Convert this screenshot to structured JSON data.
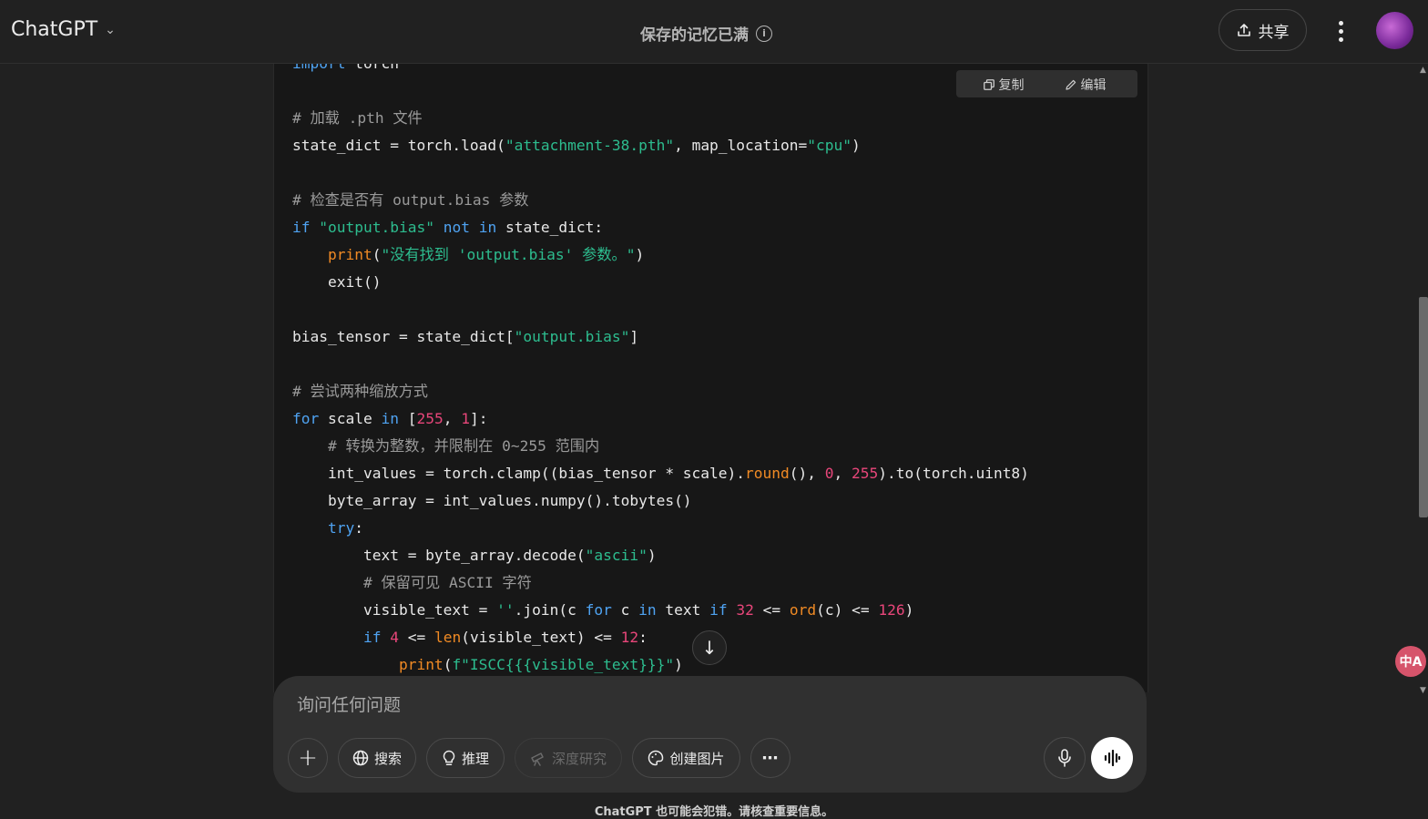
{
  "header": {
    "model_name": "ChatGPT",
    "memory_notice": "保存的记忆已满",
    "share_label": "共享"
  },
  "code_block": {
    "copy_label": "复制",
    "edit_label": "编辑",
    "lines": [
      [
        {
          "t": "import",
          "c": "kw"
        },
        {
          "t": " torch",
          "c": ""
        }
      ],
      [],
      [
        {
          "t": "# 加载 .pth 文件",
          "c": "cm"
        }
      ],
      [
        {
          "t": "state_dict = torch.load(",
          "c": ""
        },
        {
          "t": "\"attachment-38.pth\"",
          "c": "str"
        },
        {
          "t": ", map_location=",
          "c": ""
        },
        {
          "t": "\"cpu\"",
          "c": "str"
        },
        {
          "t": ")",
          "c": ""
        }
      ],
      [],
      [
        {
          "t": "# 检查是否有 output.bias 参数",
          "c": "cm"
        }
      ],
      [
        {
          "t": "if",
          "c": "kw"
        },
        {
          "t": " ",
          "c": ""
        },
        {
          "t": "\"output.bias\"",
          "c": "str"
        },
        {
          "t": " ",
          "c": ""
        },
        {
          "t": "not",
          "c": "kw"
        },
        {
          "t": " ",
          "c": ""
        },
        {
          "t": "in",
          "c": "kw"
        },
        {
          "t": " state_dict:",
          "c": ""
        }
      ],
      [
        {
          "t": "    ",
          "c": ""
        },
        {
          "t": "print",
          "c": "fn"
        },
        {
          "t": "(",
          "c": ""
        },
        {
          "t": "\"没有找到 'output.bias' 参数。\"",
          "c": "str"
        },
        {
          "t": ")",
          "c": ""
        }
      ],
      [
        {
          "t": "    exit()",
          "c": ""
        }
      ],
      [],
      [
        {
          "t": "bias_tensor = state_dict[",
          "c": ""
        },
        {
          "t": "\"output.bias\"",
          "c": "str"
        },
        {
          "t": "]",
          "c": ""
        }
      ],
      [],
      [
        {
          "t": "# 尝试两种缩放方式",
          "c": "cm"
        }
      ],
      [
        {
          "t": "for",
          "c": "kw"
        },
        {
          "t": " scale ",
          "c": ""
        },
        {
          "t": "in",
          "c": "kw"
        },
        {
          "t": " [",
          "c": ""
        },
        {
          "t": "255",
          "c": "num"
        },
        {
          "t": ", ",
          "c": ""
        },
        {
          "t": "1",
          "c": "num"
        },
        {
          "t": "]:",
          "c": ""
        }
      ],
      [
        {
          "t": "    ",
          "c": ""
        },
        {
          "t": "# 转换为整数，并限制在 0~255 范围内",
          "c": "cm"
        }
      ],
      [
        {
          "t": "    int_values = torch.clamp((bias_tensor * scale).",
          "c": ""
        },
        {
          "t": "round",
          "c": "fn"
        },
        {
          "t": "(), ",
          "c": ""
        },
        {
          "t": "0",
          "c": "num"
        },
        {
          "t": ", ",
          "c": ""
        },
        {
          "t": "255",
          "c": "num"
        },
        {
          "t": ").to(torch.uint8)",
          "c": ""
        }
      ],
      [
        {
          "t": "    byte_array = int_values.numpy().tobytes()",
          "c": ""
        }
      ],
      [
        {
          "t": "    ",
          "c": ""
        },
        {
          "t": "try",
          "c": "kw"
        },
        {
          "t": ":",
          "c": ""
        }
      ],
      [
        {
          "t": "        text = byte_array.decode(",
          "c": ""
        },
        {
          "t": "\"ascii\"",
          "c": "str"
        },
        {
          "t": ")",
          "c": ""
        }
      ],
      [
        {
          "t": "        ",
          "c": ""
        },
        {
          "t": "# 保留可见 ASCII 字符",
          "c": "cm"
        }
      ],
      [
        {
          "t": "        visible_text = ",
          "c": ""
        },
        {
          "t": "''",
          "c": "str"
        },
        {
          "t": ".join(c ",
          "c": ""
        },
        {
          "t": "for",
          "c": "kw"
        },
        {
          "t": " c ",
          "c": ""
        },
        {
          "t": "in",
          "c": "kw"
        },
        {
          "t": " text ",
          "c": ""
        },
        {
          "t": "if",
          "c": "kw"
        },
        {
          "t": " ",
          "c": ""
        },
        {
          "t": "32",
          "c": "num"
        },
        {
          "t": " <= ",
          "c": ""
        },
        {
          "t": "ord",
          "c": "fn"
        },
        {
          "t": "(c) <= ",
          "c": ""
        },
        {
          "t": "126",
          "c": "num"
        },
        {
          "t": ")",
          "c": ""
        }
      ],
      [
        {
          "t": "        ",
          "c": ""
        },
        {
          "t": "if",
          "c": "kw"
        },
        {
          "t": " ",
          "c": ""
        },
        {
          "t": "4",
          "c": "num"
        },
        {
          "t": " <= ",
          "c": ""
        },
        {
          "t": "len",
          "c": "fn"
        },
        {
          "t": "(visible_text) <= ",
          "c": ""
        },
        {
          "t": "12",
          "c": "num"
        },
        {
          "t": ":",
          "c": ""
        }
      ],
      [
        {
          "t": "            ",
          "c": ""
        },
        {
          "t": "print",
          "c": "fn"
        },
        {
          "t": "(",
          "c": ""
        },
        {
          "t": "f\"ISCC{{{visible_text}}}\"",
          "c": "str"
        },
        {
          "t": ")",
          "c": ""
        }
      ]
    ]
  },
  "composer": {
    "placeholder": "询问任何问题",
    "search_label": "搜索",
    "reason_label": "推理",
    "deep_research_label": "深度研究",
    "create_image_label": "创建图片"
  },
  "footer": {
    "disclaimer": "ChatGPT 也可能会犯错。请核查重要信息。"
  },
  "colors": {
    "keyword": "#4fa3f2",
    "string": "#2dbd8f",
    "number": "#e8467a",
    "function": "#f08a24",
    "comment": "#9a9a9a"
  }
}
